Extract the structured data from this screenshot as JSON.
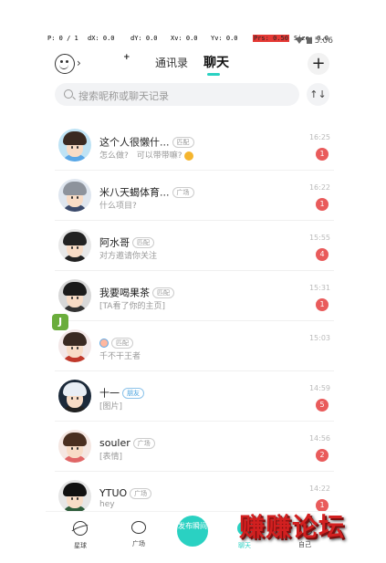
{
  "debug_overlay": {
    "p": "P: 0 / 1",
    "dx": "dX: 0.0",
    "dy": "dY: 0.0",
    "xv": "Xv: 0.0",
    "yv": "Yv: 0.0",
    "prs": "Prs: 0.50",
    "size": "Size: 0.0"
  },
  "status_bar": {
    "time": "5:06"
  },
  "header": {
    "tabs": [
      {
        "label": "通讯录"
      },
      {
        "label": "聊天"
      }
    ],
    "active_tab": "聊天"
  },
  "search": {
    "placeholder": "搜索昵称或聊天记录"
  },
  "sort_icon": "↑↓",
  "chats": [
    {
      "name": "这个人很懒什...",
      "tag": "匹配",
      "preview": "怎么做?　可以带带嘛?",
      "time": "16:25",
      "unread": "1",
      "hair": "#3a2a22",
      "shirt": "#5aa7e6",
      "bg": "#bfe3f5"
    },
    {
      "name": "米八天蝎体育...",
      "tag": "广场",
      "preview": "什么项目?",
      "time": "16:22",
      "unread": "1",
      "hair": "#8d939c",
      "shirt": "#3b4a6b",
      "bg": "#dfe6ef"
    },
    {
      "name": "阿水哥",
      "tag": "匹配",
      "preview": "对方邀请你关注",
      "time": "15:55",
      "unread": "4",
      "hair": "#222",
      "shirt": "#222",
      "bg": "#e8e8e8"
    },
    {
      "name": "我要喝果茶",
      "tag": "匹配",
      "preview": "[TA看了你的主页]",
      "time": "15:31",
      "unread": "1",
      "hair": "#1b1b1b",
      "shirt": "#333",
      "bg": "#d8d8d8"
    },
    {
      "name": "",
      "tag": "匹配",
      "preview": "千不干王者",
      "time": "15:03",
      "unread": "",
      "hair": "#3a2a22",
      "shirt": "#c0392b",
      "bg": "#f3e8e8"
    },
    {
      "name": "十一",
      "tag": "朋友",
      "preview": "[图片]",
      "time": "14:59",
      "unread": "5",
      "hair": "#e8eef5",
      "shirt": "#222",
      "bg": "#1c2a3a"
    },
    {
      "name": "souler",
      "tag": "广场",
      "preview": "[表情]",
      "time": "14:56",
      "unread": "2",
      "hair": "#4a2f20",
      "shirt": "#e06666",
      "bg": "#f5e7e2"
    },
    {
      "name": "YTUO",
      "tag": "广场",
      "preview": "hey",
      "time": "14:22",
      "unread": "1",
      "hair": "#111",
      "shirt": "#2e5c3a",
      "bg": "#e6e6e6"
    }
  ],
  "bottom_nav": {
    "planet": "星球",
    "square": "广场",
    "publish": "发布瞬间",
    "chat": "聊天",
    "self": "自己"
  },
  "watermark": "赚赚论坛",
  "colors": {
    "accent": "#2ad1c2",
    "badge": "#e95b5b"
  }
}
